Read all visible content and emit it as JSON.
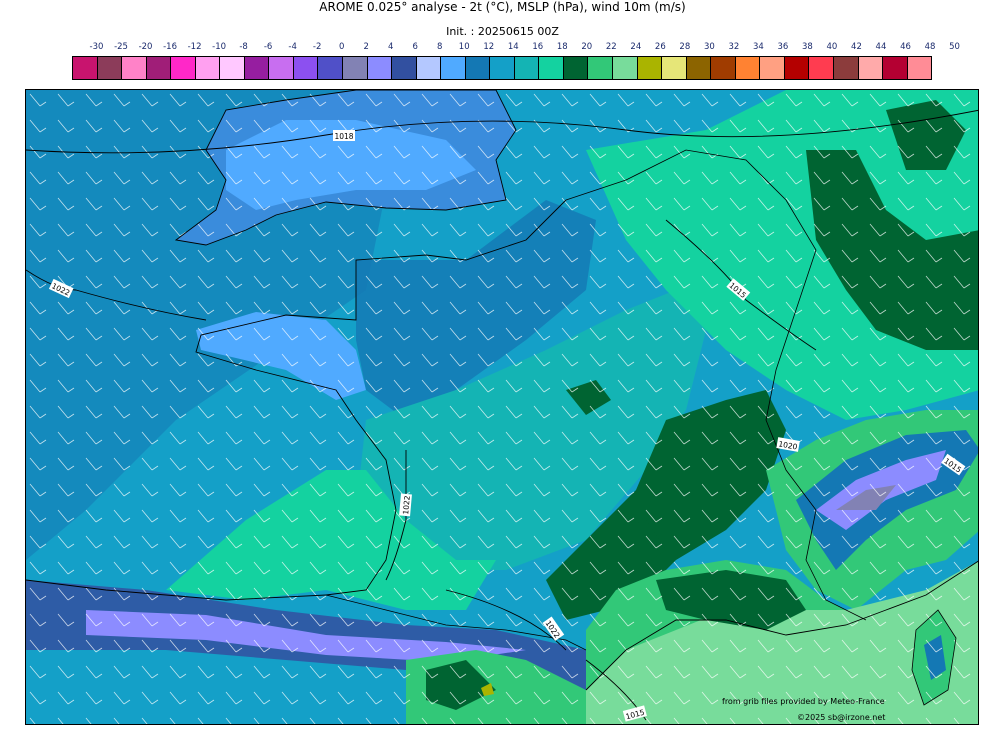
{
  "header": {
    "title": "AROME 0.025° analyse - 2t (°C), MSLP (hPa), wind 10m (m/s)",
    "subtitle": "Init. : 20250615 00Z"
  },
  "colorbar": {
    "ticks": [
      "-30",
      "-25",
      "-20",
      "-16",
      "-12",
      "-10",
      "-8",
      "-6",
      "-4",
      "-2",
      "0",
      "2",
      "4",
      "6",
      "8",
      "10",
      "12",
      "14",
      "16",
      "18",
      "20",
      "22",
      "24",
      "26",
      "28",
      "30",
      "32",
      "34",
      "36",
      "38",
      "40",
      "42",
      "44",
      "46",
      "48",
      "50"
    ],
    "colors": [
      "#c8146e",
      "#8c3c5a",
      "#ff82c8",
      "#a01e78",
      "#ff28c8",
      "#ffa0f0",
      "#ffc8ff",
      "#961ea0",
      "#c86ef0",
      "#8c50f0",
      "#5050c8",
      "#8282b4",
      "#8c8cff",
      "#3250a0",
      "#b4c8ff",
      "#50aaff",
      "#1478b4",
      "#14a0c8",
      "#14b4b4",
      "#14d2a0",
      "#006432",
      "#32c878",
      "#78dc9b",
      "#aab400",
      "#e6e678",
      "#8c6400",
      "#a03c00",
      "#ff8232",
      "#ffa082",
      "#b40000",
      "#ff3c50",
      "#8c3c3c",
      "#ffaaaa",
      "#b40032",
      "#ff8c96"
    ]
  },
  "map": {
    "isobar_labels": [
      "1018",
      "1022",
      "1015",
      "1020",
      "1015",
      "1022",
      "1022",
      "1015"
    ]
  },
  "credits": {
    "source": "from grib files provided by Meteo-France",
    "copyright": "©2025 sb@irzone.net"
  }
}
